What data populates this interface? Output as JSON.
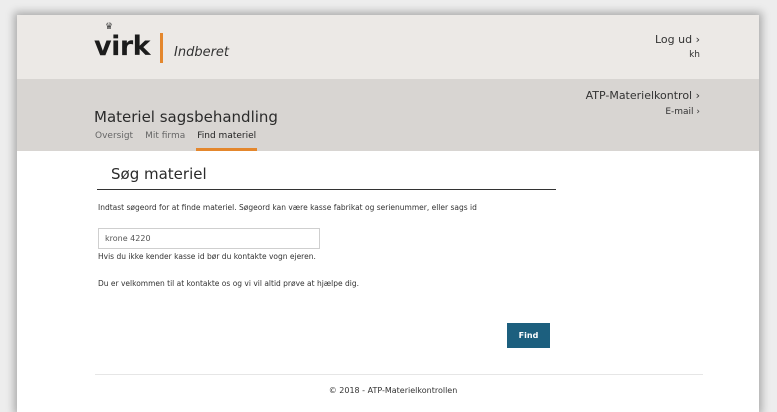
{
  "header": {
    "logo_crown": "♛",
    "logo_text": "virk",
    "app_name": "Indberet",
    "logout_label": "Log ud ›",
    "user_initials": "kh"
  },
  "subheader": {
    "title": "Materiel sagsbehandling",
    "atp_link": "ATP-Materielkontrol ›",
    "email_link": "E-mail ›",
    "tabs": [
      {
        "label": "Oversigt",
        "active": false
      },
      {
        "label": "Mit firma",
        "active": false
      },
      {
        "label": "Find materiel",
        "active": true
      }
    ]
  },
  "main": {
    "section_title": "Søg materiel",
    "intro_text": "Indtast søgeord for at finde materiel. Søgeord kan være kasse fabrikat og serienummer, eller sags id",
    "search_value": "krone 4220",
    "hint_text": "Hvis du ikke kender kasse id bør du kontakte vogn ejeren.",
    "welcome_text": "Du er velkommen til at kontakte os og vi vil altid prøve at hjælpe dig.",
    "find_button": "Find"
  },
  "footer": {
    "text": "© 2018 - ATP-Materielkontrollen"
  },
  "colors": {
    "accent": "#e4872d",
    "button": "#1c5f7e",
    "header_bg": "#ece9e6",
    "subheader_bg": "#d8d5d2"
  }
}
